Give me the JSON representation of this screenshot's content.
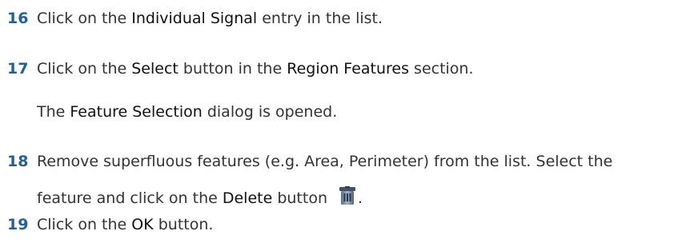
{
  "steps": [
    {
      "number": "16",
      "parts": [
        "Click on the ",
        "Individual Signal",
        " entry in the list."
      ]
    },
    {
      "number": "17",
      "parts": [
        "Click on the ",
        "Select",
        " button in the ",
        "Region Features",
        " section."
      ],
      "result_parts": [
        "The ",
        "Feature Selection",
        " dialog is opened."
      ]
    },
    {
      "number": "18",
      "line1": "Remove superfluous features (e.g. Area, Perimeter) from the list. Select the",
      "line2_parts": [
        "feature and click on the ",
        "Delete",
        " button",
        "."
      ],
      "icon": "trash-icon"
    },
    {
      "number": "19",
      "parts": [
        "Click on the ",
        "OK",
        " button."
      ]
    }
  ]
}
